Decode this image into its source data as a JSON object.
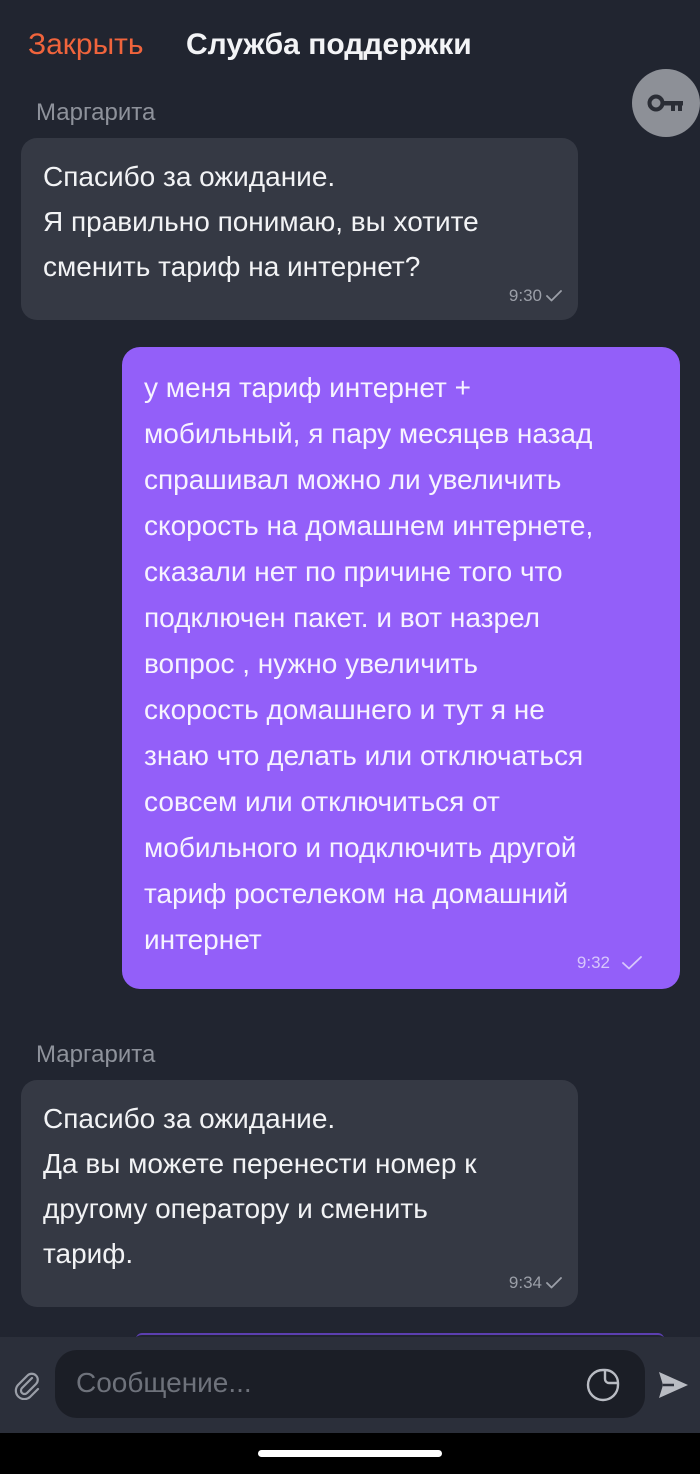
{
  "header": {
    "close_label": "Закрыть",
    "title": "Служба поддержки"
  },
  "messages": [
    {
      "sender": "Маргарита",
      "direction": "incoming",
      "lines": [
        "Спасибо за ожидание.",
        "Я правильно понимаю, вы хотите",
        "сменить тариф на интернет?"
      ],
      "time": "9:30",
      "status_icon": "check-icon"
    },
    {
      "direction": "outgoing",
      "lines": [
        "у меня тариф интернет +",
        "мобильный, я пару месяцев назад",
        "спрашивал можно ли увеличить",
        "скорость на домашнем интернете,",
        "сказали нет по причине того что",
        "подключен пакет. и вот назрел",
        "вопрос , нужно увеличить",
        "скорость домашнего и тут я не",
        "знаю что делать или отключаться",
        "совсем или отключиться от",
        "мобильного и подключить другой",
        "тариф ростелеком на домашний",
        "интернет"
      ],
      "time": "9:32",
      "status_icon": "check-icon"
    },
    {
      "sender": "Маргарита",
      "direction": "incoming",
      "lines": [
        "Спасибо за ожидание.",
        "Да вы можете перенести номер к",
        "другому оператору и сменить",
        "тариф."
      ],
      "time": "9:34",
      "status_icon": "check-icon"
    }
  ],
  "composer": {
    "placeholder": "Сообщение..."
  },
  "colors": {
    "background": "#212530",
    "accent": "#f0643c",
    "outgoing_bubble": "#935ff9",
    "incoming_bubble": "#353944"
  },
  "icons": {
    "key": "key-icon",
    "attach": "paperclip-icon",
    "sticker": "sticker-icon",
    "send": "send-icon"
  }
}
